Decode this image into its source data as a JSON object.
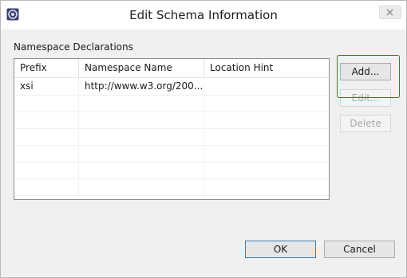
{
  "window": {
    "title": "Edit Schema Information",
    "icon": "eclipse-app-icon",
    "close_icon": "close-icon"
  },
  "section": {
    "label": "Namespace Declarations"
  },
  "table": {
    "columns": [
      "Prefix",
      "Namespace Name",
      "Location Hint"
    ],
    "rows": [
      {
        "prefix": "xsi",
        "namespace": "http://www.w3.org/200...",
        "location": ""
      }
    ]
  },
  "side_buttons": {
    "add": "Add...",
    "edit": "Edit...",
    "delete": "Delete"
  },
  "footer": {
    "ok": "OK",
    "cancel": "Cancel"
  },
  "colors": {
    "highlight": "#e8202a"
  }
}
